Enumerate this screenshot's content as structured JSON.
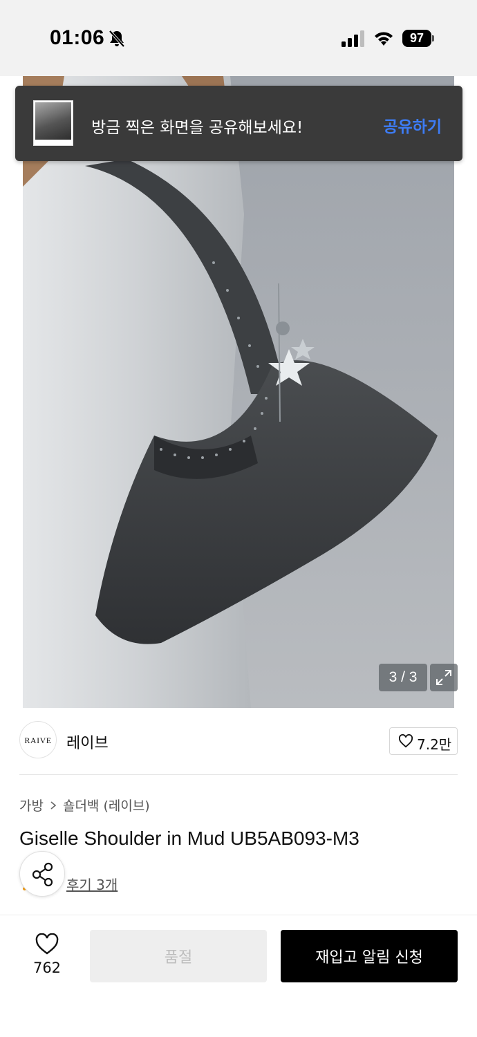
{
  "status_bar": {
    "time": "01:06",
    "battery": "97",
    "icons": [
      "bell-slash-icon",
      "cellular-signal-icon",
      "wifi-icon",
      "battery-icon"
    ]
  },
  "share_toast": {
    "message": "방금 찍은 화면을 공유해보세요!",
    "action": "공유하기",
    "action_color": "#3d7cf5"
  },
  "gallery": {
    "counter": "3 / 3",
    "expand_icon": "expand-icon"
  },
  "brand": {
    "logo_text": "RAIVE",
    "name": "레이브",
    "like_count": "7.2만"
  },
  "breadcrumb": {
    "category": "가방",
    "subcategory": "숄더백 (레이브)"
  },
  "product": {
    "title": "Giselle Shoulder in Mud UB5AB093-M3",
    "review_link": "후기 3개"
  },
  "bottom_bar": {
    "wish_count": "762",
    "soldout_label": "품절",
    "restock_label": "재입고 알림 신청"
  }
}
